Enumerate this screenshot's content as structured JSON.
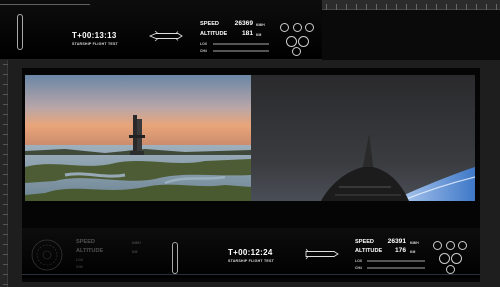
{
  "hud_top": {
    "timer": "T+00:13:13",
    "caption": "STARSHIP FLIGHT TEST",
    "speed_label": "SPEED",
    "speed_value": "26369",
    "speed_unit": "KM/H",
    "altitude_label": "ALTITUDE",
    "altitude_value": "181",
    "altitude_unit": "KM",
    "lox_label": "LOX",
    "ch4_label": "CH4"
  },
  "hud_bottom": {
    "timer": "T+00:12:24",
    "caption": "STARSHIP FLIGHT TEST",
    "speed_label": "SPEED",
    "speed_value": "26391",
    "speed_unit": "KM/H",
    "altitude_label": "ALTITUDE",
    "altitude_value": "176",
    "altitude_unit": "KM",
    "lox_label": "LOX",
    "ch4_label": "CH4",
    "booster_speed_label": "SPEED",
    "booster_speed_unit": "KM/H",
    "booster_altitude_label": "ALTITUDE",
    "booster_altitude_unit": "KM",
    "booster_lox_label": "LOX",
    "booster_ch4_label": "CH4"
  },
  "colors": {
    "hud_background": "#000000",
    "canvas": "#1e1e1e",
    "sky_dusk": "#e9a57a",
    "earth_limb": "#5f93d8"
  },
  "icons": [
    "starship-icon",
    "engine-cluster-icon",
    "booster-engine-ring-icon",
    "booster-icon"
  ]
}
